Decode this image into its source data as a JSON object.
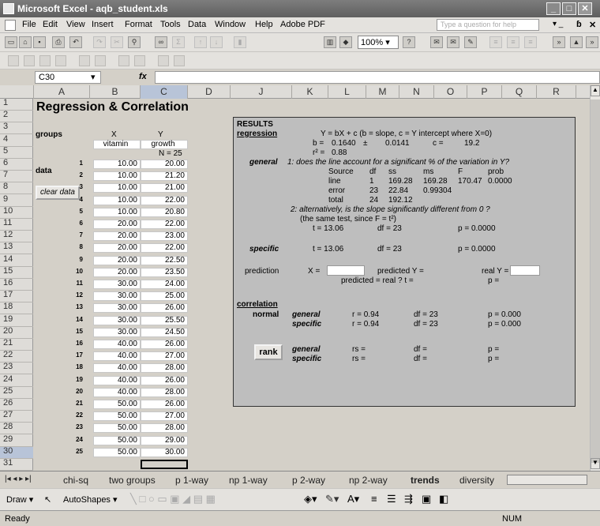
{
  "titlebar": {
    "title": "Microsoft Excel - aqb_student.xls"
  },
  "menu": [
    "File",
    "Edit",
    "View",
    "Insert",
    "Format",
    "Tools",
    "Data",
    "Window",
    "Help",
    "Adobe PDF"
  ],
  "help_placeholder": "Type a question for help",
  "zoom": "100%",
  "namebox": "C30",
  "fx": "fx",
  "columns": [
    "A",
    "B",
    "C",
    "D",
    "J",
    "K",
    "L",
    "M",
    "N",
    "O",
    "P",
    "Q",
    "R"
  ],
  "rows": [
    "1",
    "2",
    "3",
    "4",
    "5",
    "6",
    "7",
    "8",
    "9",
    "10",
    "11",
    "12",
    "13",
    "14",
    "15",
    "16",
    "17",
    "18",
    "19",
    "20",
    "21",
    "22",
    "23",
    "24",
    "25",
    "26",
    "27",
    "28",
    "29",
    "30",
    "31"
  ],
  "sheet": {
    "title": "Regression & Correlation",
    "groups_label": "groups",
    "x_label": "X",
    "y_label": "Y",
    "x_name": "vitamin",
    "y_name": "growth",
    "n_label": "N = 25",
    "data_label": "data",
    "clear_button": "clear data",
    "data_rows": [
      {
        "n": "1",
        "x": "10.00",
        "y": "20.00"
      },
      {
        "n": "2",
        "x": "10.00",
        "y": "21.20"
      },
      {
        "n": "3",
        "x": "10.00",
        "y": "21.00"
      },
      {
        "n": "4",
        "x": "10.00",
        "y": "22.00"
      },
      {
        "n": "5",
        "x": "10.00",
        "y": "20.80"
      },
      {
        "n": "6",
        "x": "20.00",
        "y": "22.00"
      },
      {
        "n": "7",
        "x": "20.00",
        "y": "23.00"
      },
      {
        "n": "8",
        "x": "20.00",
        "y": "22.00"
      },
      {
        "n": "9",
        "x": "20.00",
        "y": "22.50"
      },
      {
        "n": "10",
        "x": "20.00",
        "y": "23.50"
      },
      {
        "n": "11",
        "x": "30.00",
        "y": "24.00"
      },
      {
        "n": "12",
        "x": "30.00",
        "y": "25.00"
      },
      {
        "n": "13",
        "x": "30.00",
        "y": "26.00"
      },
      {
        "n": "14",
        "x": "30.00",
        "y": "25.50"
      },
      {
        "n": "15",
        "x": "30.00",
        "y": "24.50"
      },
      {
        "n": "16",
        "x": "40.00",
        "y": "26.00"
      },
      {
        "n": "17",
        "x": "40.00",
        "y": "27.00"
      },
      {
        "n": "18",
        "x": "40.00",
        "y": "28.00"
      },
      {
        "n": "19",
        "x": "40.00",
        "y": "26.00"
      },
      {
        "n": "20",
        "x": "40.00",
        "y": "28.00"
      },
      {
        "n": "21",
        "x": "50.00",
        "y": "26.00"
      },
      {
        "n": "22",
        "x": "50.00",
        "y": "27.00"
      },
      {
        "n": "23",
        "x": "50.00",
        "y": "28.00"
      },
      {
        "n": "24",
        "x": "50.00",
        "y": "29.00"
      },
      {
        "n": "25",
        "x": "50.00",
        "y": "30.00"
      }
    ]
  },
  "results": {
    "header": "RESULTS",
    "regression": "regression",
    "eq": "Y = bX + c  (b = slope, c = Y intercept where X=0)",
    "b_label": "b =",
    "b_val": "0.1640",
    "pm": "±",
    "b_se": "0.0141",
    "c_label": "c =",
    "c_val": "19.2",
    "r2_label": "r² =",
    "r2_val": "0.88",
    "general": "general",
    "q1": "1: does the line account for a significant % of the variation in Y?",
    "anova_head": [
      "Source",
      "df",
      "ss",
      "ms",
      "F",
      "prob"
    ],
    "anova_line": [
      "line",
      "1",
      "169.28",
      "169.28",
      "170.47",
      "0.0000"
    ],
    "anova_error": [
      "error",
      "23",
      "22.84",
      "0.99304"
    ],
    "anova_total": [
      "total",
      "24",
      "192.12"
    ],
    "q2": "2: alternatively, is the slope significantly different from 0 ?",
    "q2b": "(the same test, since F = t²)",
    "t1": "t = 13.06",
    "df1": "df = 23",
    "p1": "p = 0.0000",
    "specific": "specific",
    "t2": "t = 13.06",
    "df2": "df = 23",
    "p2": "p = 0.0000",
    "prediction": "prediction",
    "x_eq": "X =",
    "pred_y": "predicted Y =",
    "real_y": "real Y =",
    "pred_real": "predicted = real ?  t =",
    "p_eq": "p =",
    "correlation": "correlation",
    "normal": "normal",
    "cg_r": "r = 0.94",
    "cg_df": "df = 23",
    "cg_p": "p = 0.000",
    "cs_r": "r = 0.94",
    "cs_df": "df = 23",
    "cs_p": "p = 0.000",
    "rank": "rank",
    "rs": "rs =",
    "df_blank": "df =",
    "p_blank": "p ="
  },
  "tabs": [
    "chi-sq",
    "two groups",
    "p 1-way",
    "np 1-way",
    "p 2-way",
    "np 2-way",
    "trends",
    "diversity"
  ],
  "active_tab": "trends",
  "draw": {
    "draw": "Draw ▾",
    "autoshapes": "AutoShapes ▾"
  },
  "status": {
    "left": "Ready",
    "right": "NUM"
  }
}
